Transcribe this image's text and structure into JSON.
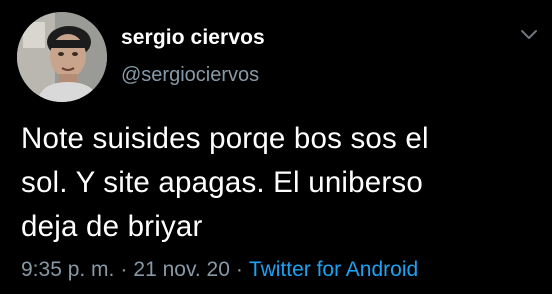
{
  "author": {
    "display_name": "sergio ciervos",
    "handle": "@sergiociervos"
  },
  "tweet": {
    "text_lines": [
      "Note suisides porqe bos sos el",
      "sol. Y site apagas. El uniberso",
      "deja de briyar"
    ],
    "time": "9:35 p. m.",
    "date": "21 nov. 20",
    "source": "Twitter for Android",
    "separator": "·"
  },
  "icons": {
    "menu": "chevron-down-icon",
    "avatar": "avatar-photo"
  },
  "colors": {
    "background": "#000000",
    "primary_text": "#ffffff",
    "secondary_text": "#8899a6",
    "link": "#1da1f2"
  }
}
